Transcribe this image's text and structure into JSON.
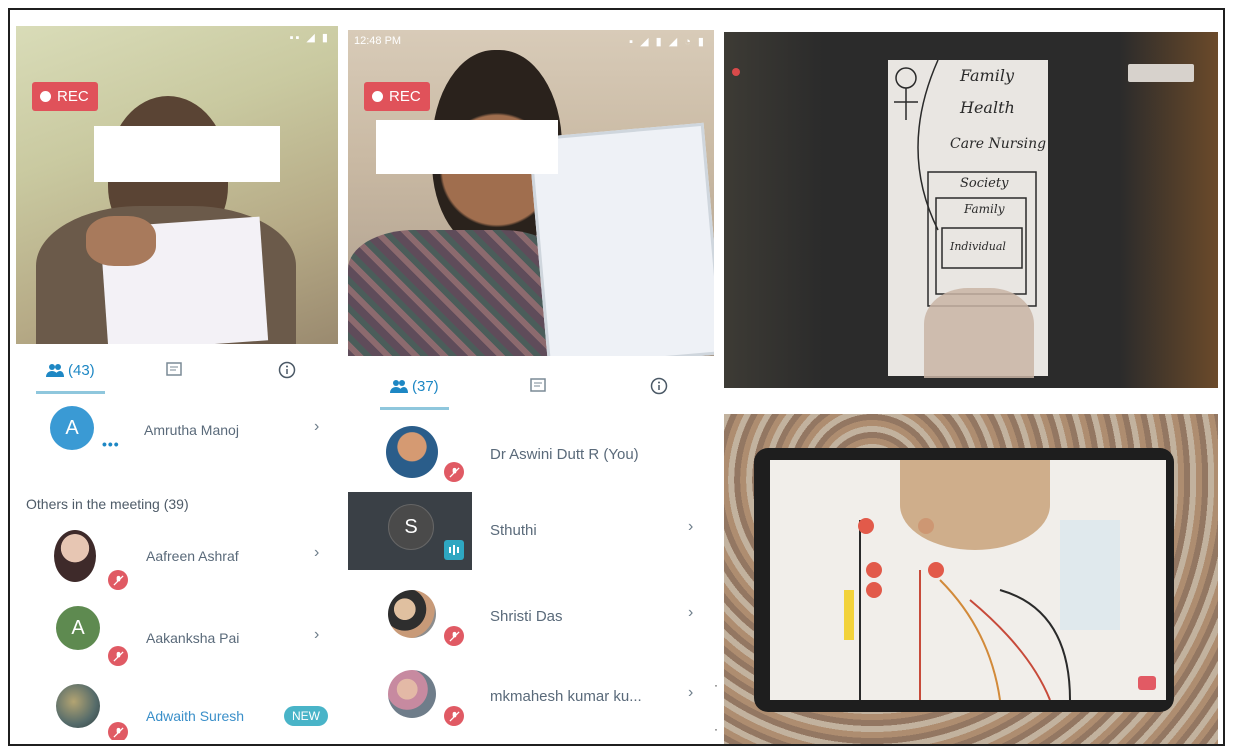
{
  "panel1": {
    "rec_label": "REC",
    "tabs": {
      "participants_count": "(43)"
    },
    "participants": [
      {
        "name": "Amrutha Manoj",
        "initial": "A"
      }
    ],
    "section_title": "Others in the meeting (39)",
    "others": [
      {
        "name": "Aafreen Ashraf"
      },
      {
        "name": "Aakanksha Pai",
        "initial": "A"
      },
      {
        "name": "Adwaith Suresh",
        "badge": "NEW"
      }
    ],
    "chevron": "›"
  },
  "panel2": {
    "status_time": "12:48 PM",
    "rec_label": "REC",
    "tabs": {
      "participants_count": "(37)"
    },
    "participants": [
      {
        "name": "Dr Aswini Dutt R (You)"
      },
      {
        "name": "Sthuthi",
        "initial": "S"
      },
      {
        "name": "Shristi Das"
      },
      {
        "name": "mkmahesh kumar ku..."
      }
    ],
    "chevron": "›"
  },
  "panel3": {
    "whiteboard_lines": [
      "Family",
      "Health",
      "Care Nursing",
      "Society",
      "Family",
      "Individual"
    ]
  },
  "colors": {
    "accent": "#1d87c4",
    "rec": "#e0525a",
    "mute": "#e05a64"
  }
}
